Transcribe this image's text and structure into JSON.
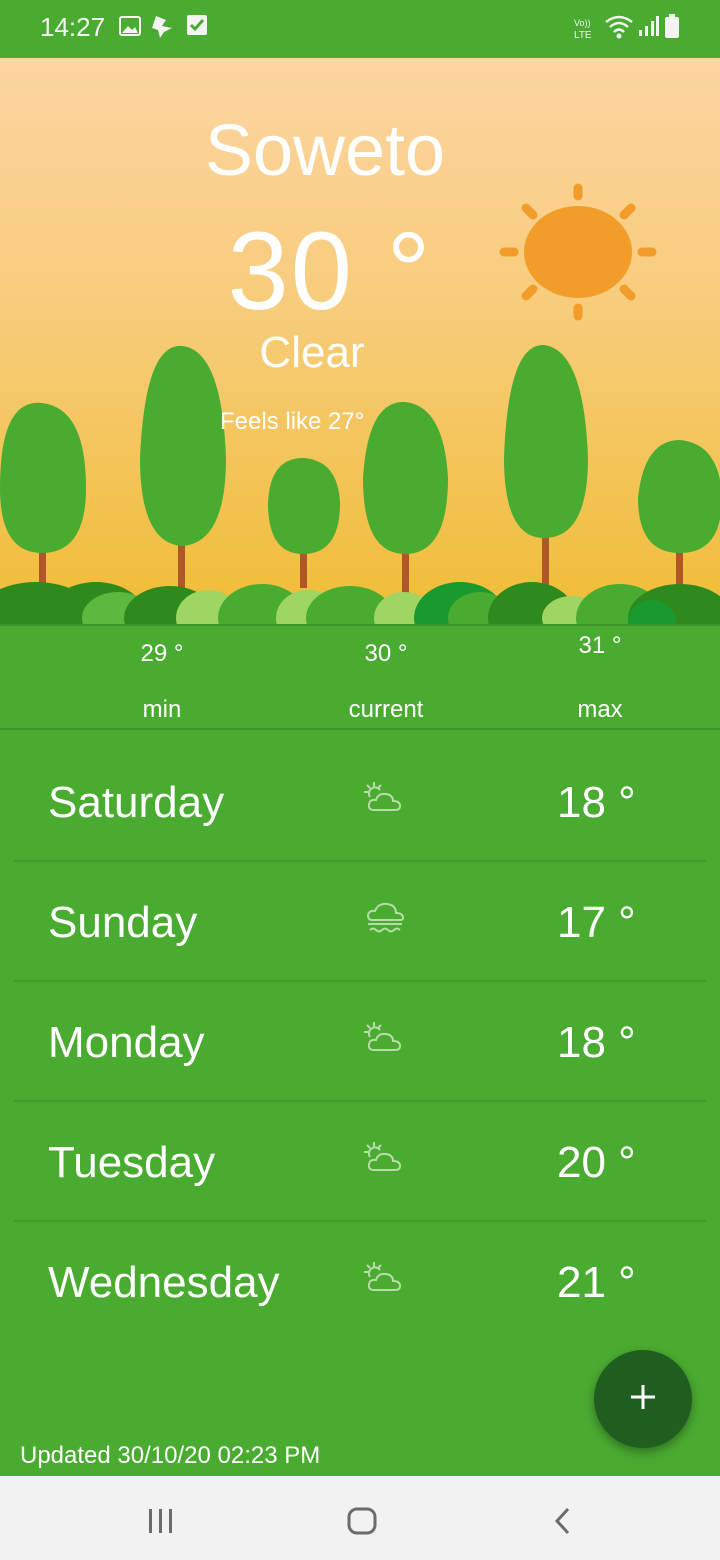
{
  "status_bar": {
    "time": "14:27",
    "icons_left": [
      "gallery-icon",
      "cast-icon",
      "checkbox-icon"
    ],
    "icons_right": [
      "volte-icon",
      "wifi-icon",
      "signal-icon",
      "battery-icon"
    ],
    "volte_text_top": "Vo))",
    "volte_text_bottom": "LTE"
  },
  "hero": {
    "city": "Soweto",
    "temperature": "30 °",
    "condition": "Clear",
    "feels_like": "Feels like 27°",
    "sky_top_color": "#fdd5a2",
    "sky_bottom_color": "#f0bc35",
    "sun_color": "#f29d2a",
    "tree_color": "#4aab31"
  },
  "stats": {
    "min": {
      "value": "29 °",
      "label": "min"
    },
    "current": {
      "value": "30 °",
      "label": "current"
    },
    "max": {
      "value": "31 °",
      "label": "max"
    }
  },
  "forecast": [
    {
      "day": "Saturday",
      "icon": "partly-cloudy-icon",
      "temp": "18 °"
    },
    {
      "day": "Sunday",
      "icon": "fog-cloud-icon",
      "temp": "17 °"
    },
    {
      "day": "Monday",
      "icon": "partly-cloudy-icon",
      "temp": "18 °"
    },
    {
      "day": "Tuesday",
      "icon": "partly-cloudy-icon",
      "temp": "20 °"
    },
    {
      "day": "Wednesday",
      "icon": "partly-cloudy-icon",
      "temp": "21 °"
    }
  ],
  "fab": {
    "icon": "plus-icon"
  },
  "updated": "Updated 30/10/20 02:23 PM",
  "navbar": {
    "buttons": [
      "recents-icon",
      "home-icon",
      "back-icon"
    ]
  },
  "colors": {
    "accent": "#4aab31",
    "fab": "#1f5e20",
    "navbar": "#f2f2f2"
  }
}
